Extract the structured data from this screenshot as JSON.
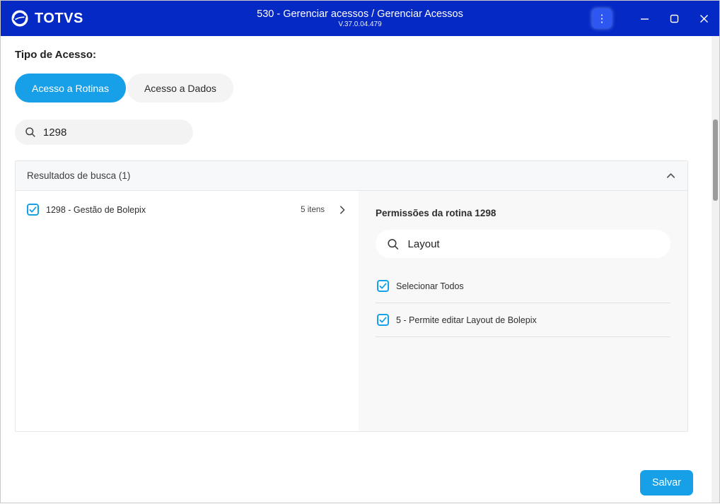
{
  "colors": {
    "titlebar": "#0529c5",
    "accent": "#17a0e8",
    "menu_button": "#2e56f0"
  },
  "titlebar": {
    "logo": "TOTVS",
    "title": "530 - Gerenciar acessos / Gerenciar Acessos",
    "version": "V.37.0.04.479",
    "icons": {
      "menu": "kebab-menu-icon",
      "minimize": "minimize-icon",
      "maximize": "maximize-icon",
      "close": "close-icon"
    }
  },
  "content": {
    "tipo_label": "Tipo de Acesso:",
    "tabs": [
      {
        "label": "Acesso a Rotinas",
        "active": true
      },
      {
        "label": "Acesso a Dados",
        "active": false
      }
    ],
    "routine_search": {
      "value": "1298"
    },
    "results": {
      "header": "Resultados de busca (1)",
      "items": [
        {
          "label": "1298 - Gestão de Bolepix",
          "count": "5 itens",
          "checked": true
        }
      ],
      "permissions": {
        "title": "Permissões da rotina 1298",
        "search": {
          "value": "Layout"
        },
        "select_all": {
          "label": "Selecionar Todos",
          "checked": true
        },
        "items": [
          {
            "label": "5 - Permite editar Layout de Bolepix",
            "checked": true
          }
        ]
      }
    },
    "save_label": "Salvar"
  }
}
